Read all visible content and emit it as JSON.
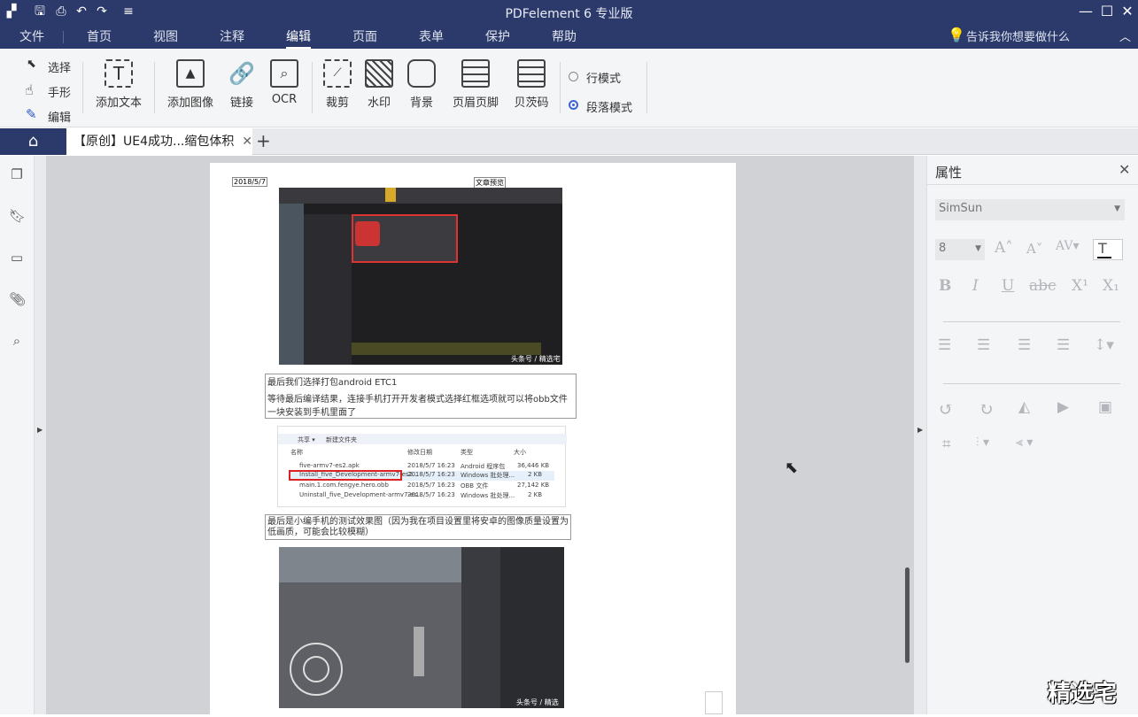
{
  "titlebar": {
    "title": "PDFelement  6 专业版",
    "quick_icons": [
      "app-logo",
      "save-icon",
      "print-icon",
      "undo-icon",
      "redo-icon",
      "customize-icon"
    ]
  },
  "menu": {
    "items": [
      "文件",
      "首页",
      "视图",
      "注释",
      "编辑",
      "页面",
      "表单",
      "保护",
      "帮助"
    ],
    "active": "编辑",
    "tell_me": "告诉我你想要做什么"
  },
  "ribbon": {
    "modes": [
      "选择",
      "手形",
      "编辑"
    ],
    "buttons": [
      "添加文本",
      "添加图像",
      "链接",
      "OCR",
      "裁剪",
      "水印",
      "背景",
      "页眉页脚",
      "贝茨码"
    ],
    "layout_options": [
      "行模式",
      "段落模式"
    ],
    "selected_layout": "段落模式"
  },
  "tabs": {
    "document_tab": "【原创】UE4成功...缩包体积"
  },
  "document": {
    "date": "2018/5/7",
    "header_center": "文章预览",
    "para1": "最后我们选择打包android ETC1",
    "para2": "等待最后编译结果，连接手机打开开发者模式选择红框选项就可以将obb文件一块安装到手机里面了",
    "para3": "最后是小编手机的测试效果图（因为我在项目设置里将安卓的图像质量设置为低画质，可能会比较模糊）",
    "shot1_watermark": "头条号 / 精选宅",
    "shot3_watermark": "头条号 / 精选宅",
    "explorer": {
      "toolbar": [
        "共享 ▾",
        "新建文件夹"
      ],
      "columns": [
        "名称",
        "修改日期",
        "类型",
        "大小"
      ],
      "rows": [
        [
          "five-armv7-es2.apk",
          "2018/5/7 16:23",
          "Android 程序包",
          "36,446 KB"
        ],
        [
          "Install_five_Development-armv7-es2...",
          "2018/5/7 16:23",
          "Windows 批处理...",
          "2 KB"
        ],
        [
          "main.1.com.fengye.hero.obb",
          "2018/5/7 16:23",
          "OBB 文件",
          "27,142 KB"
        ],
        [
          "Uninstall_five_Development-armv7-es...",
          "2018/5/7 16:23",
          "Windows 批处理...",
          "2 KB"
        ]
      ]
    }
  },
  "properties": {
    "title": "属性",
    "font": "SimSun",
    "size": "8",
    "style_glyphs": [
      "B",
      "I",
      "U",
      "abc",
      "X¹",
      "X₁"
    ]
  },
  "watermark": "精选宅"
}
